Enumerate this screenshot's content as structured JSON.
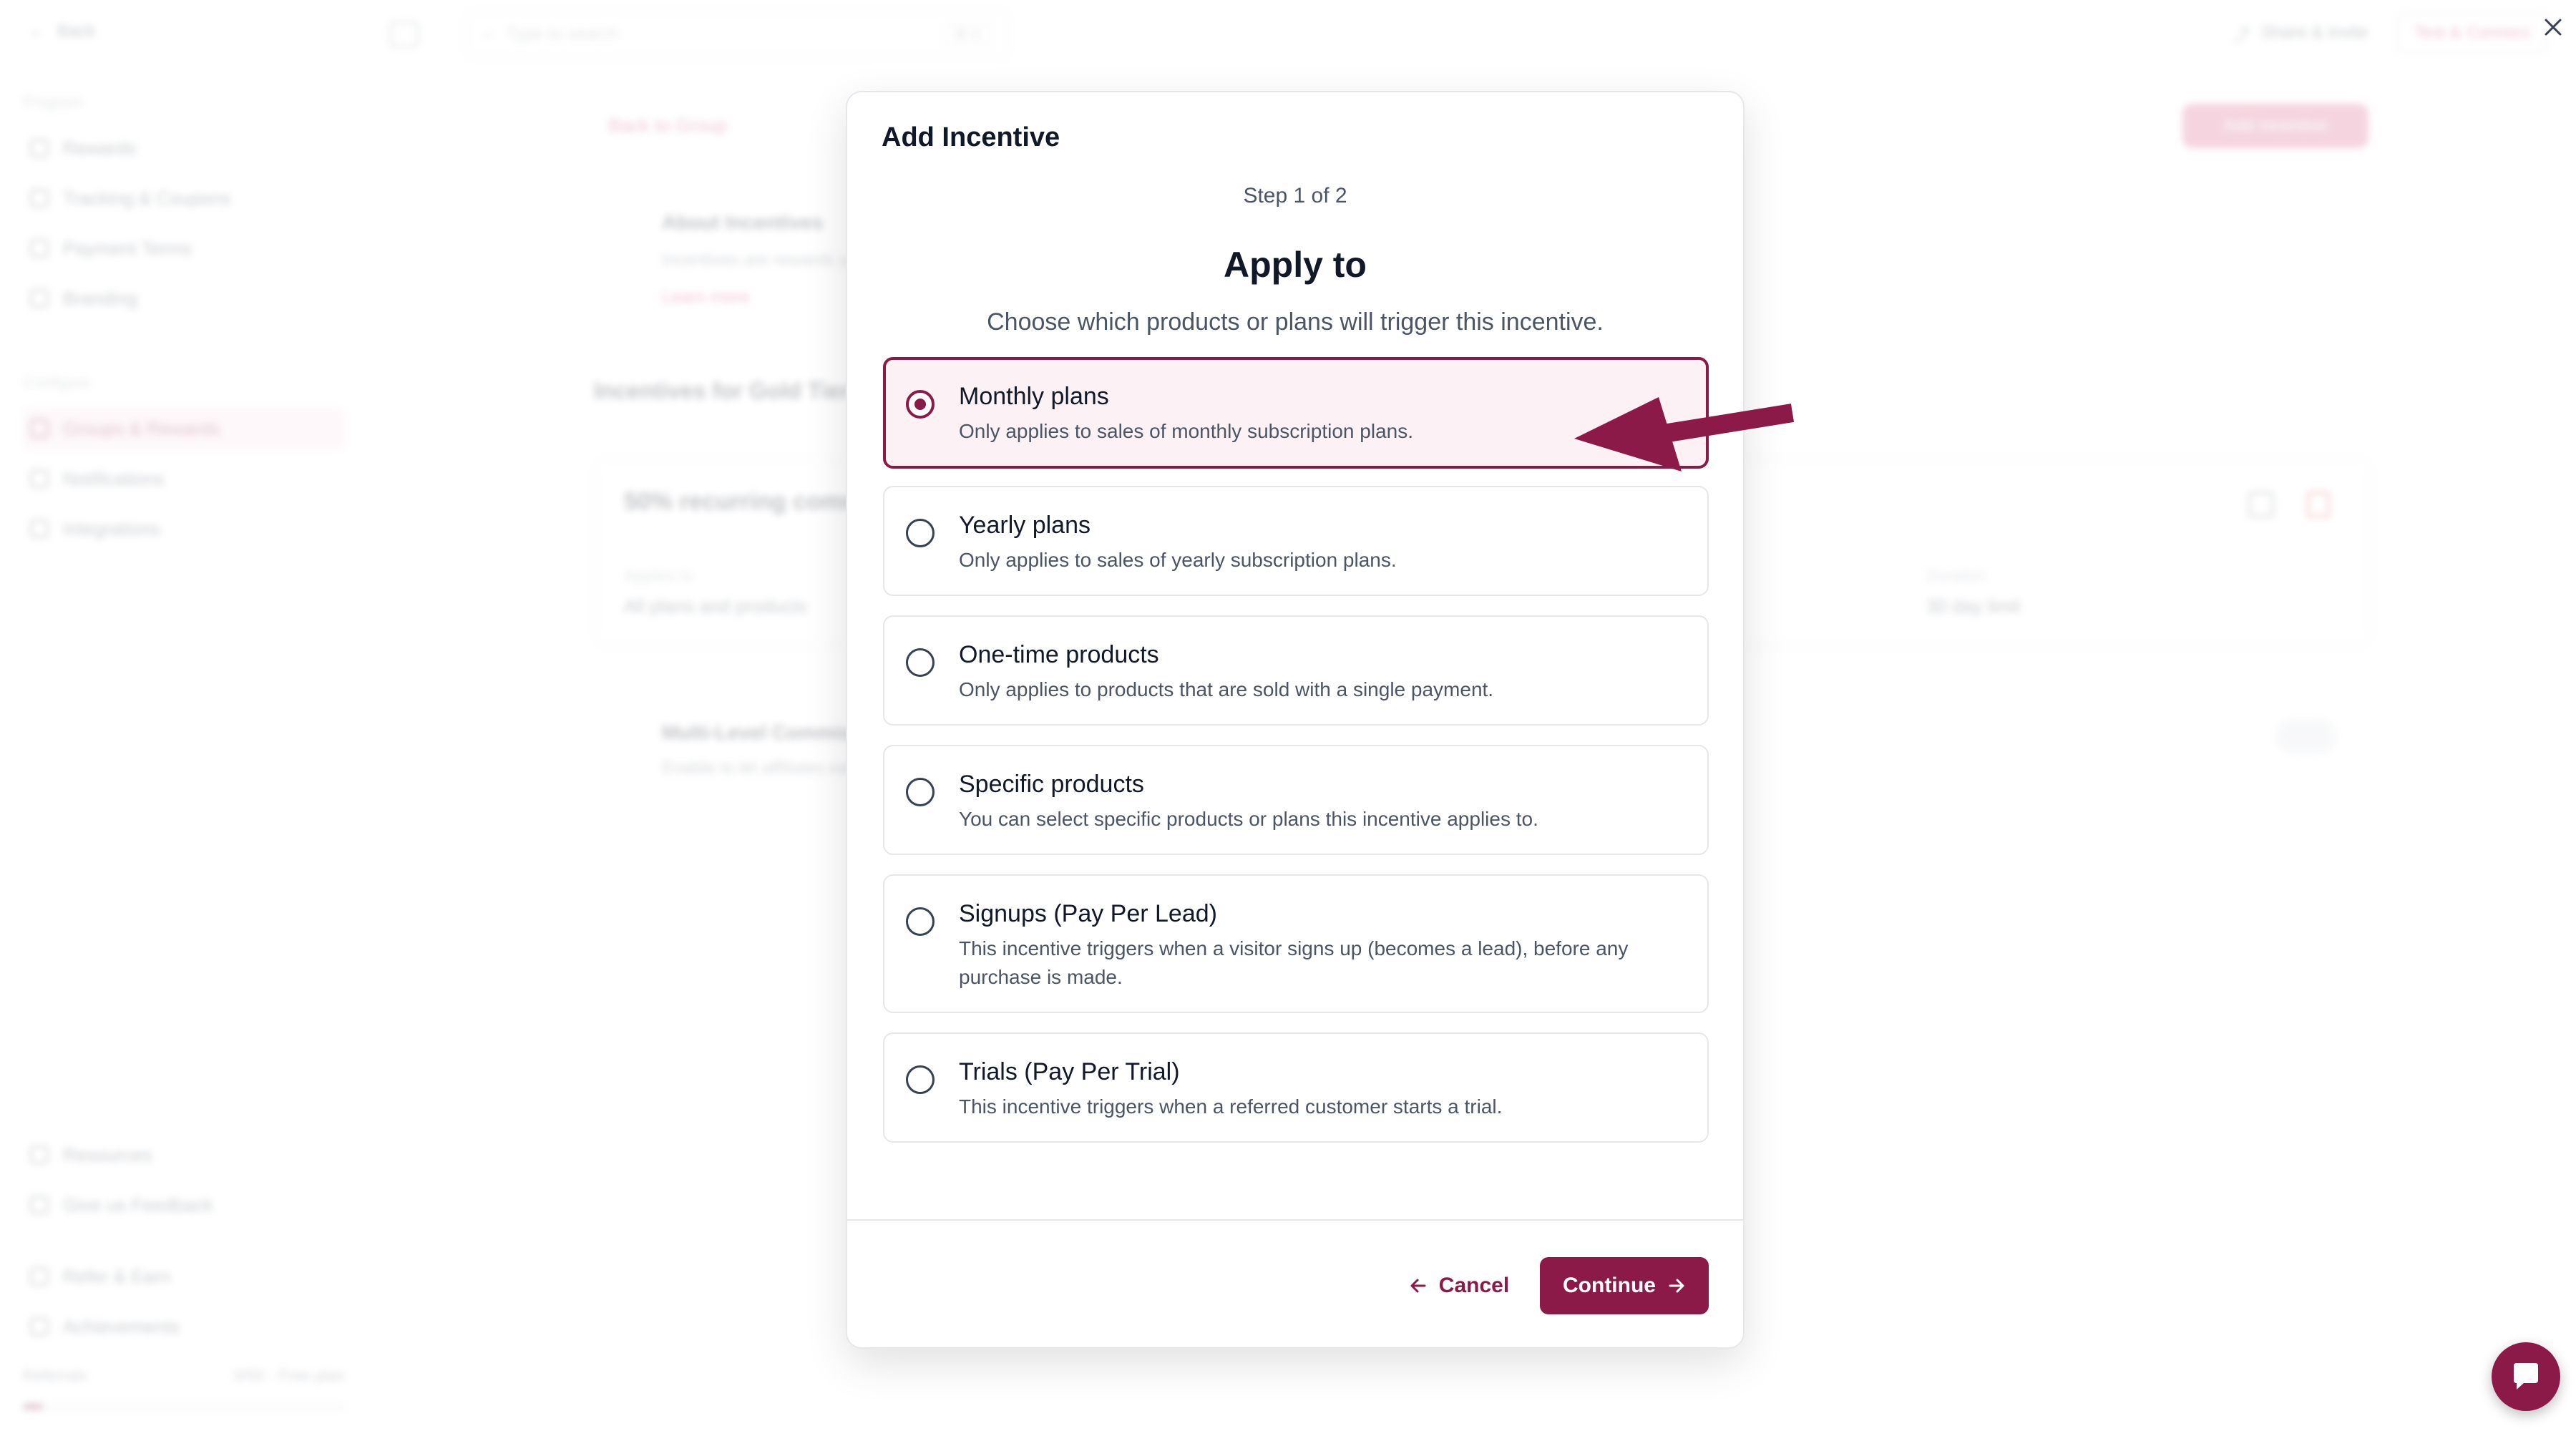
{
  "app": {
    "back_label": "Back",
    "search_placeholder": "Type to search",
    "search_shortcut": "⌘ K",
    "share_label": "Share & invite",
    "test_label": "Test & Connect",
    "sidebar": {
      "section_program": "Program",
      "program_items": [
        "Rewards",
        "Tracking & Coupons",
        "Payment Terms",
        "Branding"
      ],
      "section_configure": "Configure",
      "configure_items": [
        "Groups & Rewards",
        "Notifications",
        "Integrations"
      ],
      "bottom_items": [
        "Resources",
        "Give us Feedback",
        "Refer & Earn",
        "Achievements"
      ],
      "credits_label": "Referrals",
      "credits_value": "0/50 · Free plan"
    },
    "content": {
      "back_link": "Back to Group",
      "add_button": "Add Incentive",
      "about_title": "About Incentives",
      "about_desc": "Incentives are rewards your affiliates can earn by promoting your products, set the incentives for the Gold Tier group.",
      "learn_more": "Learn more",
      "group_title": "Incentives for Gold Tier",
      "incentive_title": "50% recurring commission",
      "applies_label": "Applies to",
      "applies_value": "All plans and products",
      "duration_label": "Duration",
      "duration_value": "30 day limit",
      "multi_title": "Multi-Level Commissions",
      "multi_desc": "Enable to let affiliates earn from their referrals' sales."
    }
  },
  "modal": {
    "title": "Add Incentive",
    "step": "Step 1 of 2",
    "heading": "Apply to",
    "subheading": "Choose which products or plans will trigger this incentive.",
    "options": [
      {
        "title": "Monthly plans",
        "desc": "Only applies to sales of monthly subscription plans."
      },
      {
        "title": "Yearly plans",
        "desc": "Only applies to sales of yearly subscription plans."
      },
      {
        "title": "One-time products",
        "desc": "Only applies to products that are sold with a single payment."
      },
      {
        "title": "Specific products",
        "desc": "You can select specific products or plans this incentive applies to."
      },
      {
        "title": "Signups (Pay Per Lead)",
        "desc": "This incentive triggers when a visitor signs up (becomes a lead), before any purchase is made."
      },
      {
        "title": "Trials (Pay Per Trial)",
        "desc": "This incentive triggers when a referred customer starts a trial."
      }
    ],
    "selected_option": "Monthly plans",
    "cancel_label": "Cancel",
    "continue_label": "Continue"
  },
  "icons": {
    "close": "close-icon",
    "cancel_arrow": "arrow-left-icon",
    "continue_arrow": "arrow-right-icon",
    "chat": "chat-bubble-icon",
    "annotation": "annotation-arrow-icon"
  },
  "colors": {
    "brand": "#8b1a48",
    "selected_bg": "#fcf1f5",
    "border": "#e5e7eb"
  }
}
